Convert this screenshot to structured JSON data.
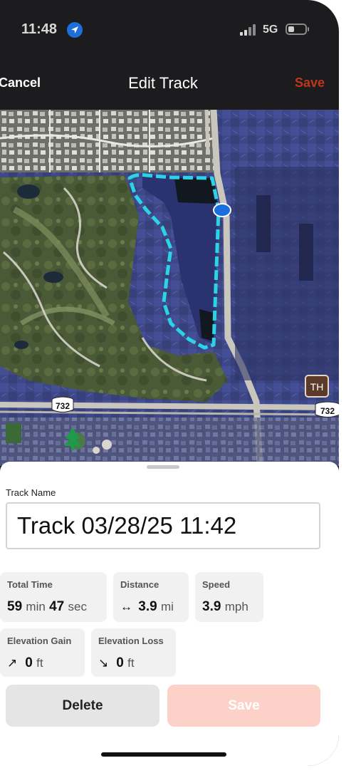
{
  "status_bar": {
    "time": "11:48",
    "network": "5G"
  },
  "nav": {
    "cancel_label": "Cancel",
    "title": "Edit Track",
    "save_label": "Save"
  },
  "map": {
    "road_labels": [
      "732",
      "732"
    ],
    "trailhead_label": "TH",
    "track_color": "#2ad4e6",
    "position_marker_color": "#1a6fe0"
  },
  "sheet": {
    "track_name_label": "Track Name",
    "track_name_value": "Track 03/28/25 11:42",
    "stats": {
      "total_time": {
        "label": "Total Time",
        "minutes": "59",
        "min_unit": "min",
        "seconds": "47",
        "sec_unit": "sec"
      },
      "distance": {
        "label": "Distance",
        "value": "3.9",
        "unit": "mi"
      },
      "speed": {
        "label": "Speed",
        "value": "3.9",
        "unit": "mph"
      },
      "elevation_gain": {
        "label": "Elevation Gain",
        "value": "0",
        "unit": "ft"
      },
      "elevation_loss": {
        "label": "Elevation Loss",
        "value": "0",
        "unit": "ft"
      }
    },
    "delete_label": "Delete",
    "save_label": "Save"
  },
  "colors": {
    "accent": "#c0361a",
    "save_disabled": "#fcd2c8"
  }
}
